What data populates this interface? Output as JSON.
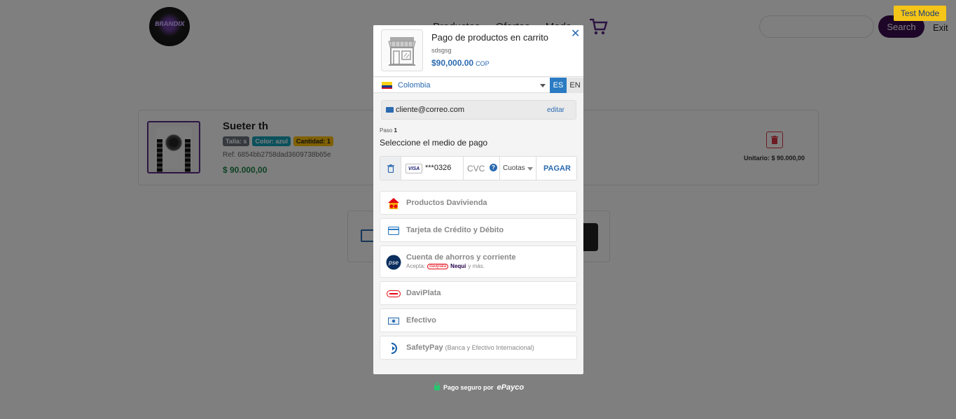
{
  "store": {
    "logo_text": "BRANDIX",
    "nav": [
      "Productos",
      "Ofertas",
      "Moda"
    ],
    "search_label": "Search",
    "exit_label": "Exit",
    "brand_color": "#3a0d4e"
  },
  "cart": {
    "item": {
      "name": "Sueter th",
      "badges": {
        "size": "Talla: s",
        "color": "Color: azul",
        "quantity": "Cantidad: 1"
      },
      "ref": "Ref: 6854bb2758dad3609738b65e",
      "price": "$ 90.000,00",
      "unit_price": "Unitario: $ 90.000,00"
    }
  },
  "test_mode_label": "Test Mode",
  "payment": {
    "title": "Pago de productos en carrito",
    "subtitle": "sdsgsg",
    "amount": "$90,000.00",
    "currency": "COP",
    "country": "Colombia",
    "languages": {
      "es": "ES",
      "en": "EN"
    },
    "email": "cliente@correo.com",
    "edit_label": "editar",
    "step_prefix": "Paso",
    "step_number": "1",
    "step_title": "Seleccione el medio de pago",
    "saved_card": {
      "brand": "VISA",
      "masked": "***0326",
      "cvc_placeholder": "CVC",
      "installments": "Cuotas",
      "pay_label": "PAGAR"
    },
    "methods": [
      {
        "label": "Productos Davivienda",
        "icon": "davivienda-house-icon"
      },
      {
        "label": "Tarjeta de Crédito y Débito",
        "icon": "credit-card-icon"
      },
      {
        "label": "Cuenta de ahorros y corriente",
        "icon": "pse-icon",
        "accepts_prefix": "Acepta:",
        "accepts_brand_1": "daviplata",
        "accepts_brand_2": "Nequi",
        "accepts_suffix": "y más."
      },
      {
        "label": "DaviPlata",
        "icon": "daviplata-icon"
      },
      {
        "label": "Efectivo",
        "icon": "cash-icon"
      },
      {
        "label": "SafetyPay",
        "note": "(Banca y Efectivo Internacional)",
        "icon": "safetypay-icon"
      }
    ],
    "footer_text": "Pago seguro por",
    "footer_brand": "ePayco",
    "accent_color": "#2a6ab0"
  }
}
